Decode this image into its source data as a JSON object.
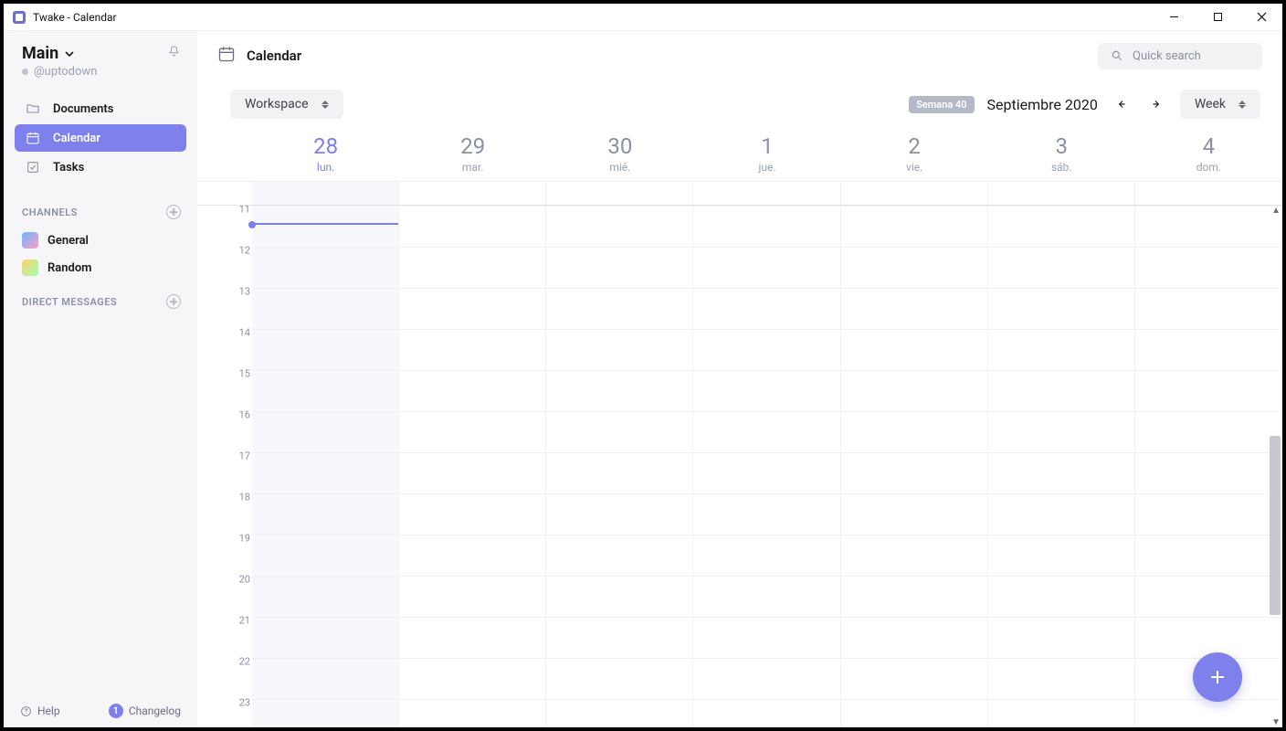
{
  "window": {
    "title": "Twake - Calendar"
  },
  "workspace": {
    "name": "Main",
    "user": "@uptodown"
  },
  "sidebar": {
    "nav": [
      {
        "label": "Documents",
        "active": false
      },
      {
        "label": "Calendar",
        "active": true
      },
      {
        "label": "Tasks",
        "active": false
      }
    ],
    "sections": {
      "channels": "CHANNELS",
      "direct": "DIRECT MESSAGES"
    },
    "channels": [
      {
        "label": "General"
      },
      {
        "label": "Random"
      }
    ],
    "footer": {
      "help": "Help",
      "changelog": "Changelog",
      "badge": "1"
    }
  },
  "header": {
    "title": "Calendar"
  },
  "search": {
    "placeholder": "Quick search"
  },
  "toolbar": {
    "filter": "Workspace",
    "weekBadge": "Semana 40",
    "month": "Septiembre 2020",
    "view": "Week"
  },
  "days": [
    {
      "num": "28",
      "name": "lun.",
      "today": true
    },
    {
      "num": "29",
      "name": "mar.",
      "today": false
    },
    {
      "num": "30",
      "name": "mié.",
      "today": false
    },
    {
      "num": "1",
      "name": "jue.",
      "today": false
    },
    {
      "num": "2",
      "name": "vie.",
      "today": false
    },
    {
      "num": "3",
      "name": "sáb.",
      "today": false
    },
    {
      "num": "4",
      "name": "dom.",
      "today": false
    }
  ],
  "hours": [
    "11",
    "12",
    "13",
    "14",
    "15",
    "16",
    "17",
    "18",
    "19",
    "20",
    "21",
    "22",
    "23"
  ],
  "hourHeightPx": 45
}
